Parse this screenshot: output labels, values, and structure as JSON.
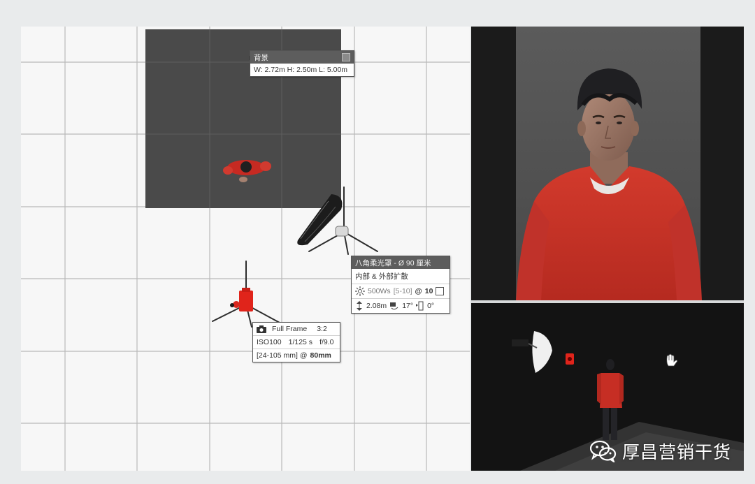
{
  "floor_plan": {
    "backdrop": {
      "title": "背景",
      "dimensions": "W: 2.72m H: 2.50m L: 5.00m"
    },
    "softbox": {
      "title": "八角柔光罩 - Ø 90 厘米",
      "diffusion": "内部 & 外部扩散",
      "power": "500Ws",
      "power_range": "[5-10]",
      "power_at": "@",
      "power_level": "10",
      "height": "2.08m",
      "tilt": "17°",
      "rotation": "0°"
    },
    "camera": {
      "sensor": "Full Frame",
      "ratio": "3:2",
      "iso": "ISO100",
      "shutter": "1/125 s",
      "aperture": "f/9.0",
      "lens_range": "[24-105 mm] @",
      "focal_length": "80mm"
    }
  },
  "watermark": {
    "text": "厚昌营销干货"
  },
  "colors": {
    "backdrop": "#4a4a4a",
    "sweater_red": "#c93428",
    "camera_red": "#e0241b",
    "panel_dark": "#1b1b1b",
    "header_gray": "#5d5d5d"
  },
  "icons": {
    "flash_power": "sun-burst-icon",
    "height": "height-arrows-icon",
    "tilt": "tilt-icon",
    "rotation": "rotation-icon",
    "camera": "camera-icon",
    "watermark": "wechat-icon"
  }
}
